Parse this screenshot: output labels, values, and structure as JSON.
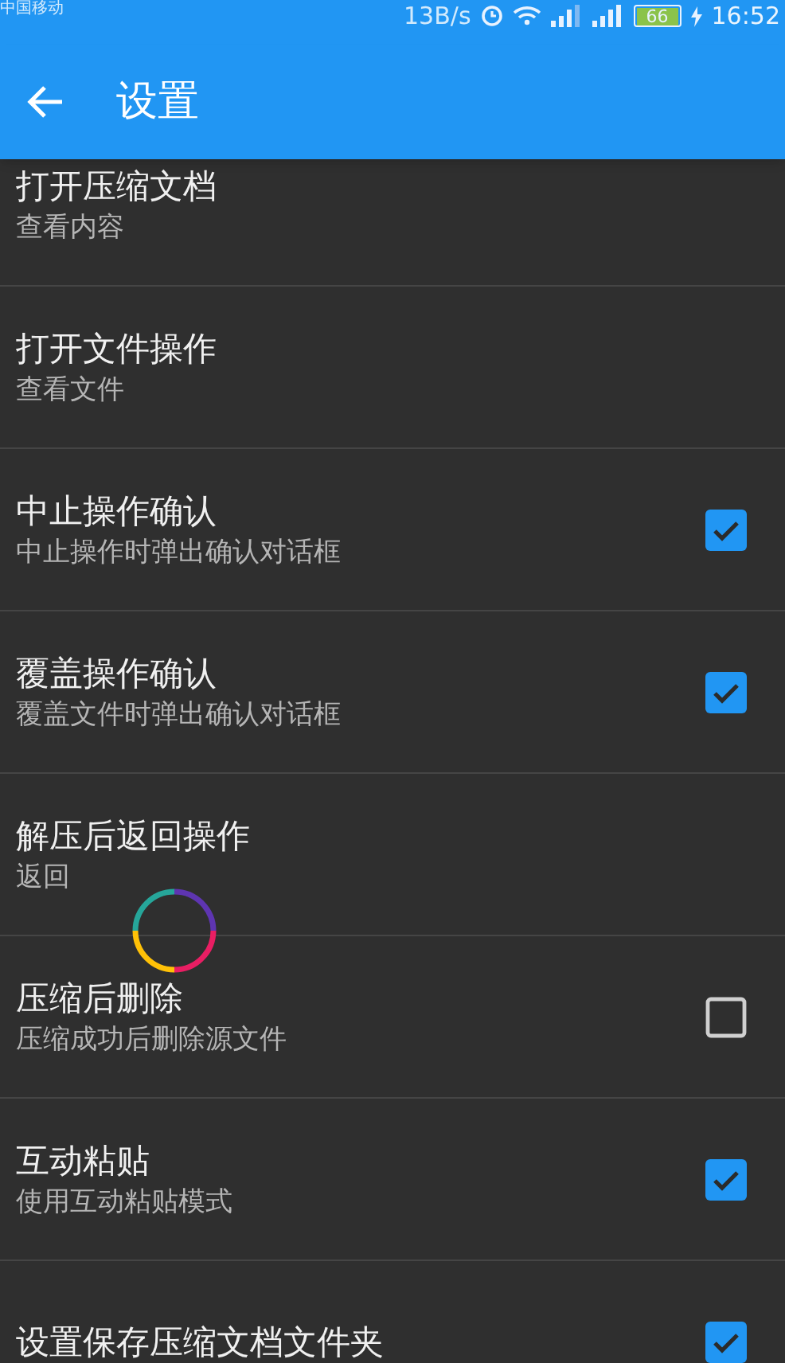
{
  "status_bar": {
    "carrier": "中国移动",
    "speed": "13B/s",
    "battery": "66",
    "time": "16:52"
  },
  "app_bar": {
    "title": "设置"
  },
  "items": [
    {
      "kind": "link",
      "title": "打开压缩文档",
      "subtitle": "查看内容"
    },
    {
      "kind": "link",
      "title": "打开文件操作",
      "subtitle": "查看文件"
    },
    {
      "kind": "toggle",
      "title": "中止操作确认",
      "subtitle": "中止操作时弹出确认对话框",
      "checked": true
    },
    {
      "kind": "toggle",
      "title": "覆盖操作确认",
      "subtitle": "覆盖文件时弹出确认对话框",
      "checked": true
    },
    {
      "kind": "link",
      "title": "解压后返回操作",
      "subtitle": "返回"
    },
    {
      "kind": "toggle",
      "title": "压缩后删除",
      "subtitle": "压缩成功后删除源文件",
      "checked": false
    },
    {
      "kind": "toggle",
      "title": "互动粘贴",
      "subtitle": "使用互动粘贴模式",
      "checked": true
    },
    {
      "kind": "toggle",
      "title": "设置保存压缩文档文件夹",
      "checked": true
    }
  ]
}
